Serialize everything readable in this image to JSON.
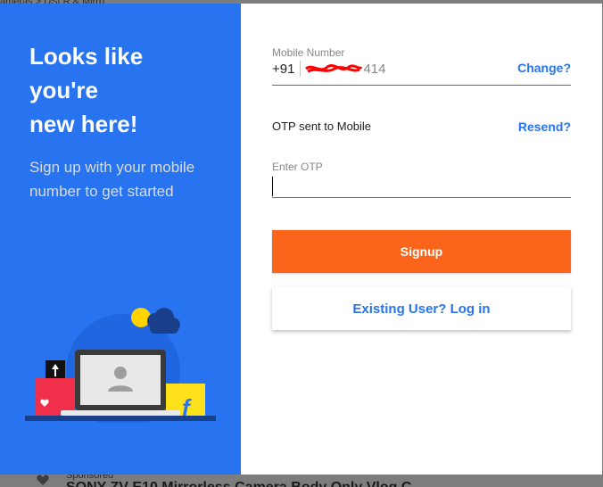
{
  "background": {
    "breadcrumb": "ameras  >  DSLR & Mirro",
    "sponsored": "Sponsored",
    "product_title": "SONY ZV-E10 Mirrorless Camera Body Only Vlog C"
  },
  "left_panel": {
    "title_line1": "Looks like you're",
    "title_line2": "new here!",
    "subtitle_line1": "Sign up with your mobile",
    "subtitle_line2": "number to get started",
    "accent_color": "#2874f0"
  },
  "form": {
    "mobile_label": "Mobile Number",
    "country_code": "+91",
    "mobile_suffix": "414",
    "change_label": "Change?",
    "otp_sent_text": "OTP sent to Mobile",
    "resend_label": "Resend?",
    "otp_label": "Enter OTP",
    "otp_value": "",
    "signup_label": "Signup",
    "login_label": "Existing User? Log in",
    "signup_color": "#fb641b"
  },
  "icons": {
    "illustration": "laptop-signup-illustration",
    "heart": "heart-icon"
  }
}
